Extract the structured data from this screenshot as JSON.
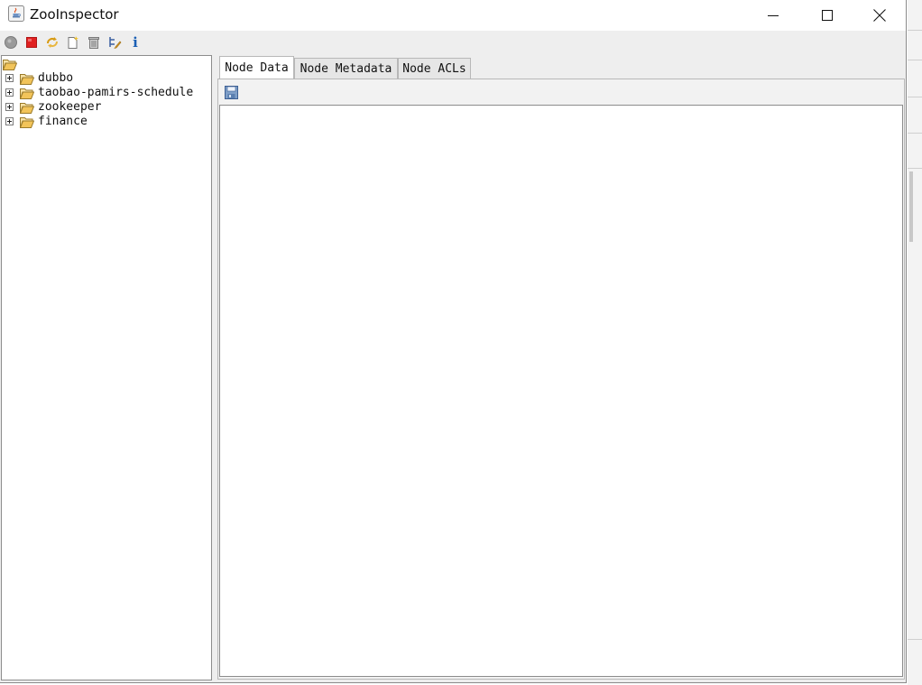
{
  "window": {
    "title": "ZooInspector"
  },
  "toolbar": {
    "buttons": [
      {
        "name": "connect",
        "icon": "connect-icon"
      },
      {
        "name": "disconnect",
        "icon": "disconnect-icon"
      },
      {
        "name": "refresh",
        "icon": "refresh-icon"
      },
      {
        "name": "add-node",
        "icon": "add-node-icon"
      },
      {
        "name": "delete-node",
        "icon": "delete-node-icon"
      },
      {
        "name": "node-viewers",
        "icon": "node-viewers-icon"
      },
      {
        "name": "about",
        "icon": "info-icon",
        "glyph": "i"
      }
    ]
  },
  "tree": {
    "root_icon": "open-folder-icon",
    "nodes": [
      {
        "label": "dubbo"
      },
      {
        "label": "taobao-pamirs-schedule"
      },
      {
        "label": "zookeeper"
      },
      {
        "label": "finance"
      }
    ]
  },
  "tabs": [
    {
      "label": "Node Data",
      "active": true
    },
    {
      "label": "Node Metadata",
      "active": false
    },
    {
      "label": "Node ACLs",
      "active": false
    }
  ],
  "node_data": {
    "save_icon": "save-icon",
    "content": ""
  },
  "colors": {
    "folder": "#f2c45a",
    "disconnect": "#e02020",
    "info": "#1a5fb4"
  }
}
